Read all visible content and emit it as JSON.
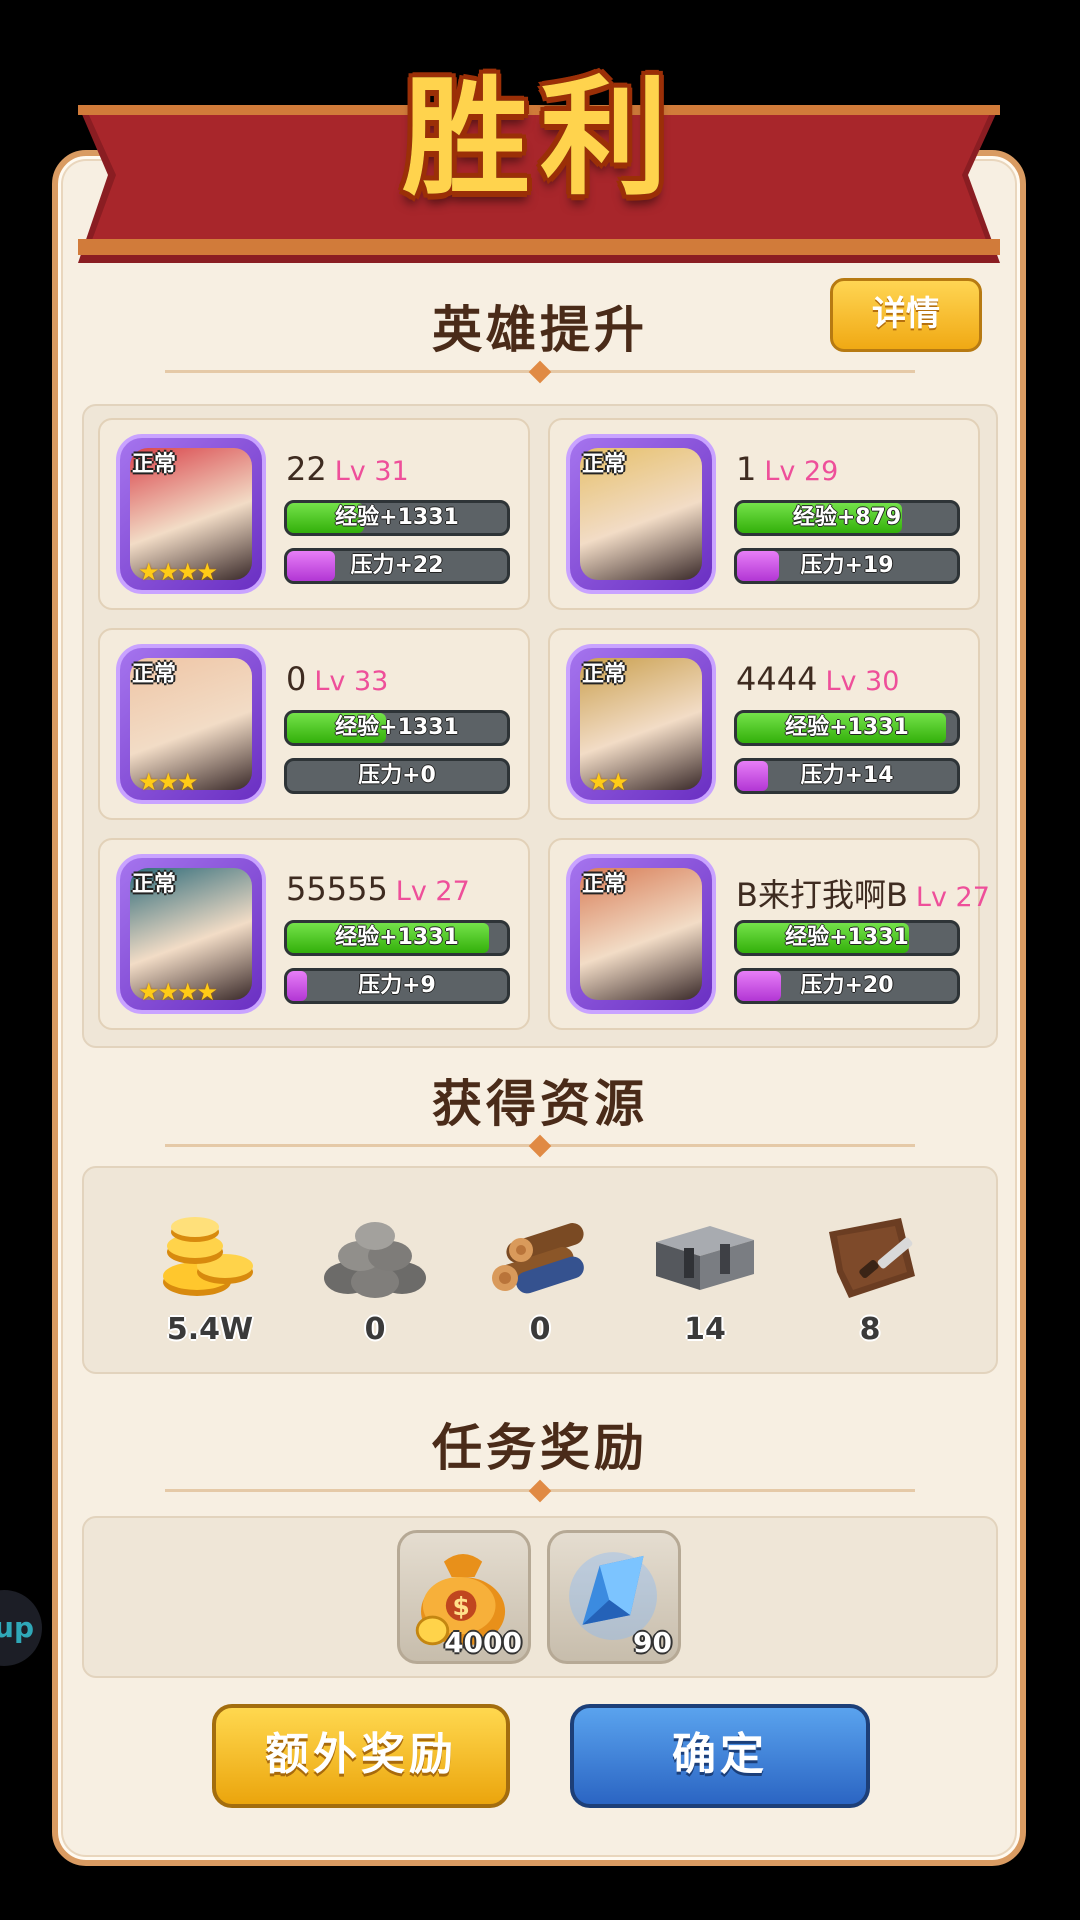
{
  "title": "胜利",
  "detail_button": "详情",
  "hero_section": {
    "title": "英雄提升",
    "heroes": [
      {
        "name": "22",
        "level": "Lv 31",
        "status": "正常",
        "stars": "★★★★",
        "exp_text": "经验+1331",
        "exp_fill": 0.35,
        "pressure_text": "压力+22",
        "pressure_fill": 0.22,
        "palette": "#d9434a"
      },
      {
        "name": "1",
        "level": "Lv 29",
        "status": "正常",
        "stars": "",
        "exp_text": "经验+879",
        "exp_fill": 0.75,
        "pressure_text": "压力+19",
        "pressure_fill": 0.19,
        "palette": "#e6c06a"
      },
      {
        "name": "0",
        "level": "Lv 33",
        "status": "正常",
        "stars": "★★★",
        "exp_text": "经验+1331",
        "exp_fill": 0.45,
        "pressure_text": "压力+0",
        "pressure_fill": 0,
        "palette": "#efc5a5"
      },
      {
        "name": "4444",
        "level": "Lv 30",
        "status": "正常",
        "stars": "★★",
        "exp_text": "经验+1331",
        "exp_fill": 0.95,
        "pressure_text": "压力+14",
        "pressure_fill": 0.14,
        "palette": "#caa04e"
      },
      {
        "name": "55555",
        "level": "Lv 27",
        "status": "正常",
        "stars": "★★★★",
        "exp_text": "经验+1331",
        "exp_fill": 0.92,
        "pressure_text": "压力+9",
        "pressure_fill": 0.09,
        "palette": "#2e6b7a"
      },
      {
        "name": "B来打我啊B",
        "level": "Lv 27",
        "status": "正常",
        "stars": "",
        "exp_text": "经验+1331",
        "exp_fill": 0.78,
        "pressure_text": "压力+20",
        "pressure_fill": 0.2,
        "palette": "#d87d57"
      }
    ]
  },
  "resource_section": {
    "title": "获得资源",
    "items": [
      {
        "icon": "gold-coins-icon",
        "value": "5.4W"
      },
      {
        "icon": "stone-icon",
        "value": "0"
      },
      {
        "icon": "wood-logs-icon",
        "value": "0"
      },
      {
        "icon": "iron-ingot-icon",
        "value": "14"
      },
      {
        "icon": "leather-icon",
        "value": "8"
      }
    ]
  },
  "mission_section": {
    "title": "任务奖励",
    "rewards": [
      {
        "icon": "money-bag-icon",
        "count": "4000"
      },
      {
        "icon": "blue-crystal-icon",
        "count": "90"
      }
    ]
  },
  "buttons": {
    "extra": "额外奖励",
    "confirm": "确定"
  },
  "side_float": "up"
}
